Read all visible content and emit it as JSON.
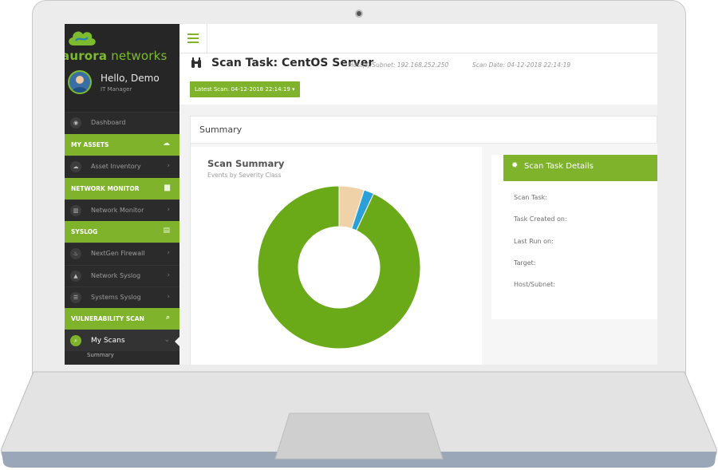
{
  "brand": {
    "name_bold": "aurora",
    "name_rest": " networks",
    "greeting": "Hello, Demo",
    "role": "IT Manager"
  },
  "sidebar": {
    "items": [
      {
        "type": "item",
        "label": "Dashboard",
        "icon": "dashboard-icon",
        "glyph": "◉"
      },
      {
        "type": "section",
        "label": "MY ASSETS",
        "icon": "assets-icon",
        "glyph": "☁"
      },
      {
        "type": "item",
        "label": "Asset Inventory",
        "icon": "cloud-icon",
        "glyph": "☁",
        "arrow": "›"
      },
      {
        "type": "section",
        "label": "NETWORK MONITOR",
        "icon": "chart-icon",
        "glyph": "▆"
      },
      {
        "type": "item",
        "label": "Network Monitor",
        "icon": "bar-chart-icon",
        "glyph": "▥",
        "arrow": "›"
      },
      {
        "type": "section",
        "label": "SYSLOG",
        "icon": "log-icon",
        "glyph": "▤"
      },
      {
        "type": "item",
        "label": "NextGen Firewall",
        "icon": "fire-icon",
        "glyph": "♨",
        "arrow": "›"
      },
      {
        "type": "item",
        "label": "Network Syslog",
        "icon": "network-icon",
        "glyph": "▲",
        "arrow": "›"
      },
      {
        "type": "item",
        "label": "Systems Syslog",
        "icon": "list-icon",
        "glyph": "☰",
        "arrow": "›"
      },
      {
        "type": "section",
        "label": "VULNERABILITY SCAN",
        "icon": "search-icon",
        "glyph": "⌕"
      },
      {
        "type": "active",
        "label": "My Scans",
        "icon": "search-icon",
        "glyph": "⌕",
        "arrow": "⌄"
      },
      {
        "type": "sub",
        "label": "Summary"
      }
    ]
  },
  "header": {
    "title": "Scan Task: CentOS Server",
    "host_subnet": "Host(s)/Subnet: 192.168.252.250",
    "scan_date": "Scan Date: 04-12-2018 22:14:19",
    "latest_scan_button": "Latest Scan: 04-12-2018 22:14:19 ▾"
  },
  "summary_card": {
    "title": "Summary",
    "scan_summary_title": "Scan Summary",
    "scan_summary_subtitle": "Events by Severity Class"
  },
  "details": {
    "title": "Scan Task Details",
    "labels": [
      "Scan Task:",
      "Task Created on:",
      "Last Run on:",
      "Target:",
      "Host/Subnet:"
    ]
  },
  "chart_data": {
    "type": "pie",
    "title": "Scan Summary",
    "subtitle": "Events by Severity Class",
    "series": [
      {
        "values": [
          5,
          2,
          93
        ],
        "colors": [
          "#f0d2a8",
          "#2a9fd8",
          "#6aaa19"
        ]
      }
    ]
  },
  "colors": {
    "accent": "#7fb32c",
    "sidebar_bg": "#2b2b2b"
  }
}
